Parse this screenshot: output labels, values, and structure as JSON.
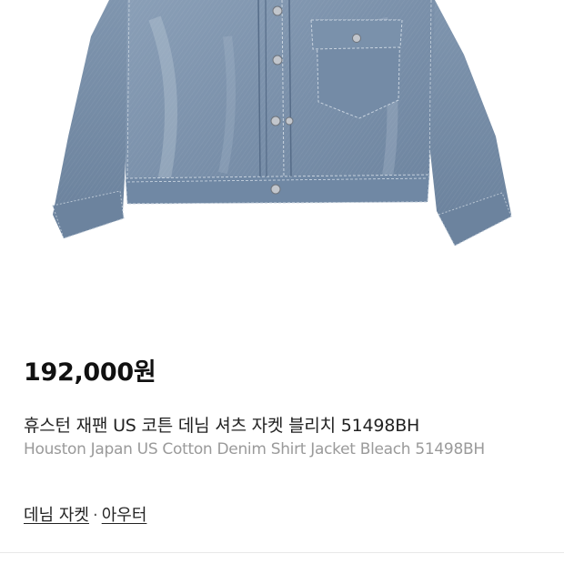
{
  "product": {
    "price": "192,000원",
    "title_ko": "휴스턴 재팬 US 코튼 데님 셔츠 자켓 블리치 51498BH",
    "title_en": "Houston Japan US Cotton Denim Shirt Jacket Bleach 51498BH"
  },
  "category": {
    "primary": "데님 자켓",
    "separator": "·",
    "secondary": "아우터"
  },
  "colors": {
    "denim_base": "#7d93ad",
    "denim_dark": "#5f7591",
    "denim_light": "#a3b4c8",
    "text_primary": "#111111",
    "text_secondary": "#9a9a9a"
  }
}
